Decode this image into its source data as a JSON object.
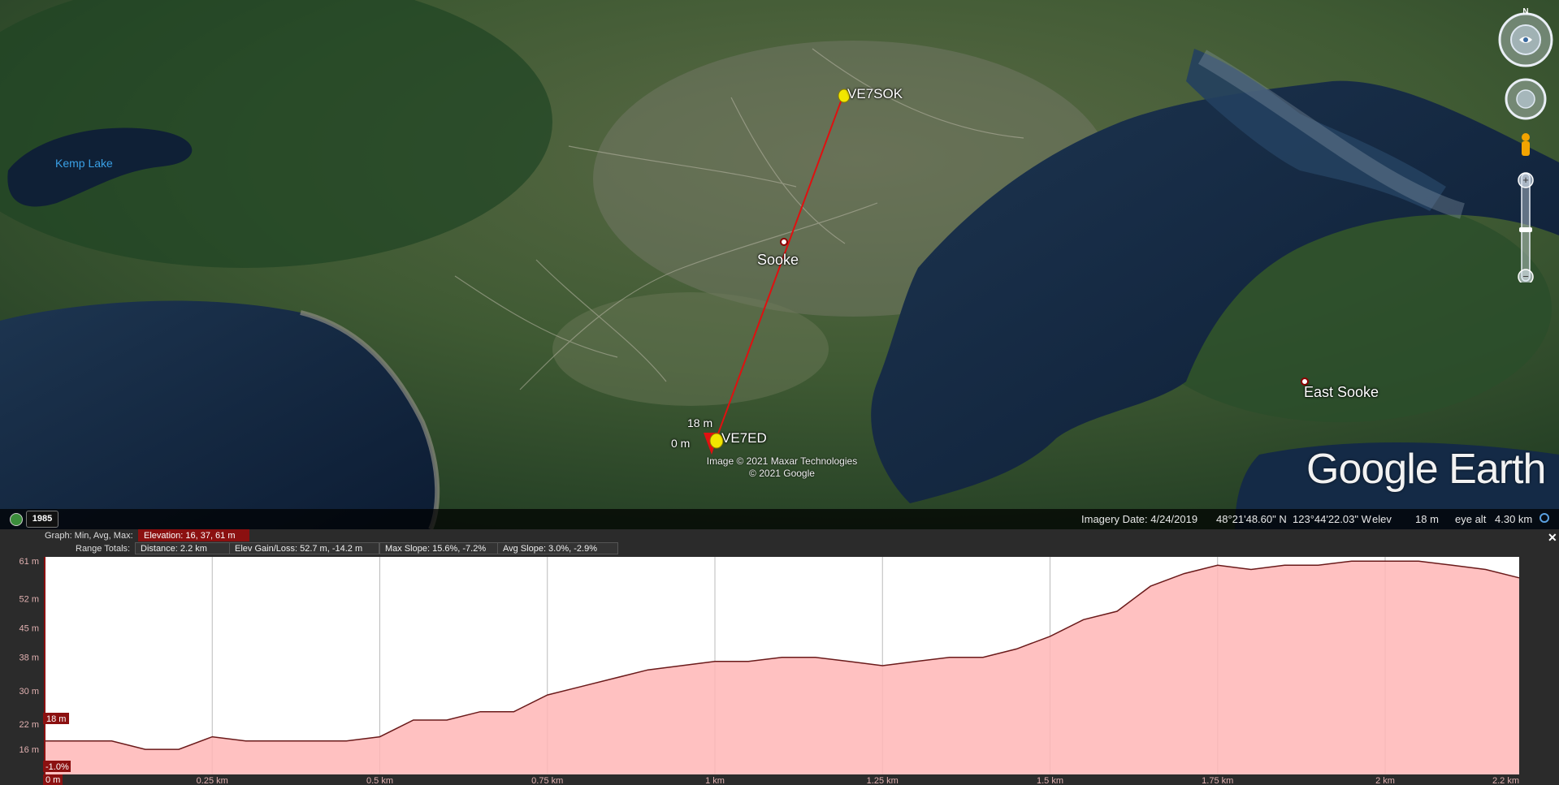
{
  "map": {
    "labels": {
      "kemp_lake": "Kemp Lake",
      "sooke": "Sooke",
      "east_sooke": "East Sooke",
      "ve7sok": "VE7SOK",
      "ve7ed": "VE7ED",
      "marker_18m": "18 m",
      "marker_0m": "0 m"
    },
    "attribution_line1": "Image © 2021 Maxar Technologies",
    "attribution_line2": "© 2021 Google",
    "logo": "Google Earth",
    "year": "1985",
    "path_color": "#e01010"
  },
  "statusbar": {
    "imagery_date": "Imagery Date: 4/24/2019",
    "lat": "48°21'48.60\" N",
    "lon": "123°44'22.03\" W",
    "elev_label": "elev",
    "elev_value": "18 m",
    "eye_alt_label": "eye alt",
    "eye_alt_value": "4.30 km"
  },
  "profile_panel": {
    "graph_label": "Graph: Min, Avg, Max:",
    "elevation": "Elevation: 16, 37, 61 m",
    "range_label": "Range Totals:",
    "distance": "Distance: 2.2 km",
    "elev_gain": "Elev Gain/Loss: 52.7 m, -14.2 m",
    "max_slope": "Max Slope: 15.6%, -7.2%",
    "avg_slope": "Avg Slope: 3.0%, -2.9%",
    "marker_elev": "18 m",
    "marker_slope": "-1.0%",
    "marker_dist": "0 m"
  },
  "chart_data": {
    "type": "area",
    "x": [
      0,
      0.1,
      0.15,
      0.2,
      0.25,
      0.3,
      0.35,
      0.4,
      0.45,
      0.5,
      0.55,
      0.6,
      0.65,
      0.7,
      0.75,
      0.8,
      0.85,
      0.9,
      0.95,
      1.0,
      1.05,
      1.1,
      1.15,
      1.2,
      1.25,
      1.3,
      1.35,
      1.4,
      1.45,
      1.5,
      1.55,
      1.6,
      1.65,
      1.7,
      1.75,
      1.8,
      1.85,
      1.9,
      1.95,
      2.0,
      2.05,
      2.1,
      2.15,
      2.2
    ],
    "y": [
      18,
      18,
      16,
      16,
      19,
      18,
      18,
      18,
      18,
      19,
      23,
      23,
      25,
      25,
      29,
      31,
      33,
      35,
      36,
      37,
      37,
      38,
      38,
      37,
      36,
      37,
      38,
      38,
      40,
      43,
      47,
      49,
      55,
      58,
      60,
      59,
      60,
      60,
      61,
      61,
      61,
      60,
      59,
      57
    ],
    "xlabel": "",
    "ylabel": "",
    "xlim": [
      0,
      2.2
    ],
    "ylim": [
      10,
      62
    ],
    "yticks": [
      16,
      22,
      30,
      38,
      45,
      52,
      61
    ],
    "ytick_labels": [
      "16 m",
      "22 m",
      "30 m",
      "38 m",
      "45 m",
      "52 m",
      "61 m"
    ],
    "xticks": [
      0,
      0.25,
      0.5,
      0.75,
      1,
      1.25,
      1.5,
      1.75,
      2,
      2.2
    ],
    "xtick_labels": [
      "0 m",
      "0.25 km",
      "0.5 km",
      "0.75 km",
      "1 km",
      "1.25 km",
      "1.5 km",
      "1.75 km",
      "2 km",
      "2.2 km"
    ],
    "grid": true,
    "line_color": "#6a1a1a",
    "fill_color": "#ffb6b6"
  }
}
